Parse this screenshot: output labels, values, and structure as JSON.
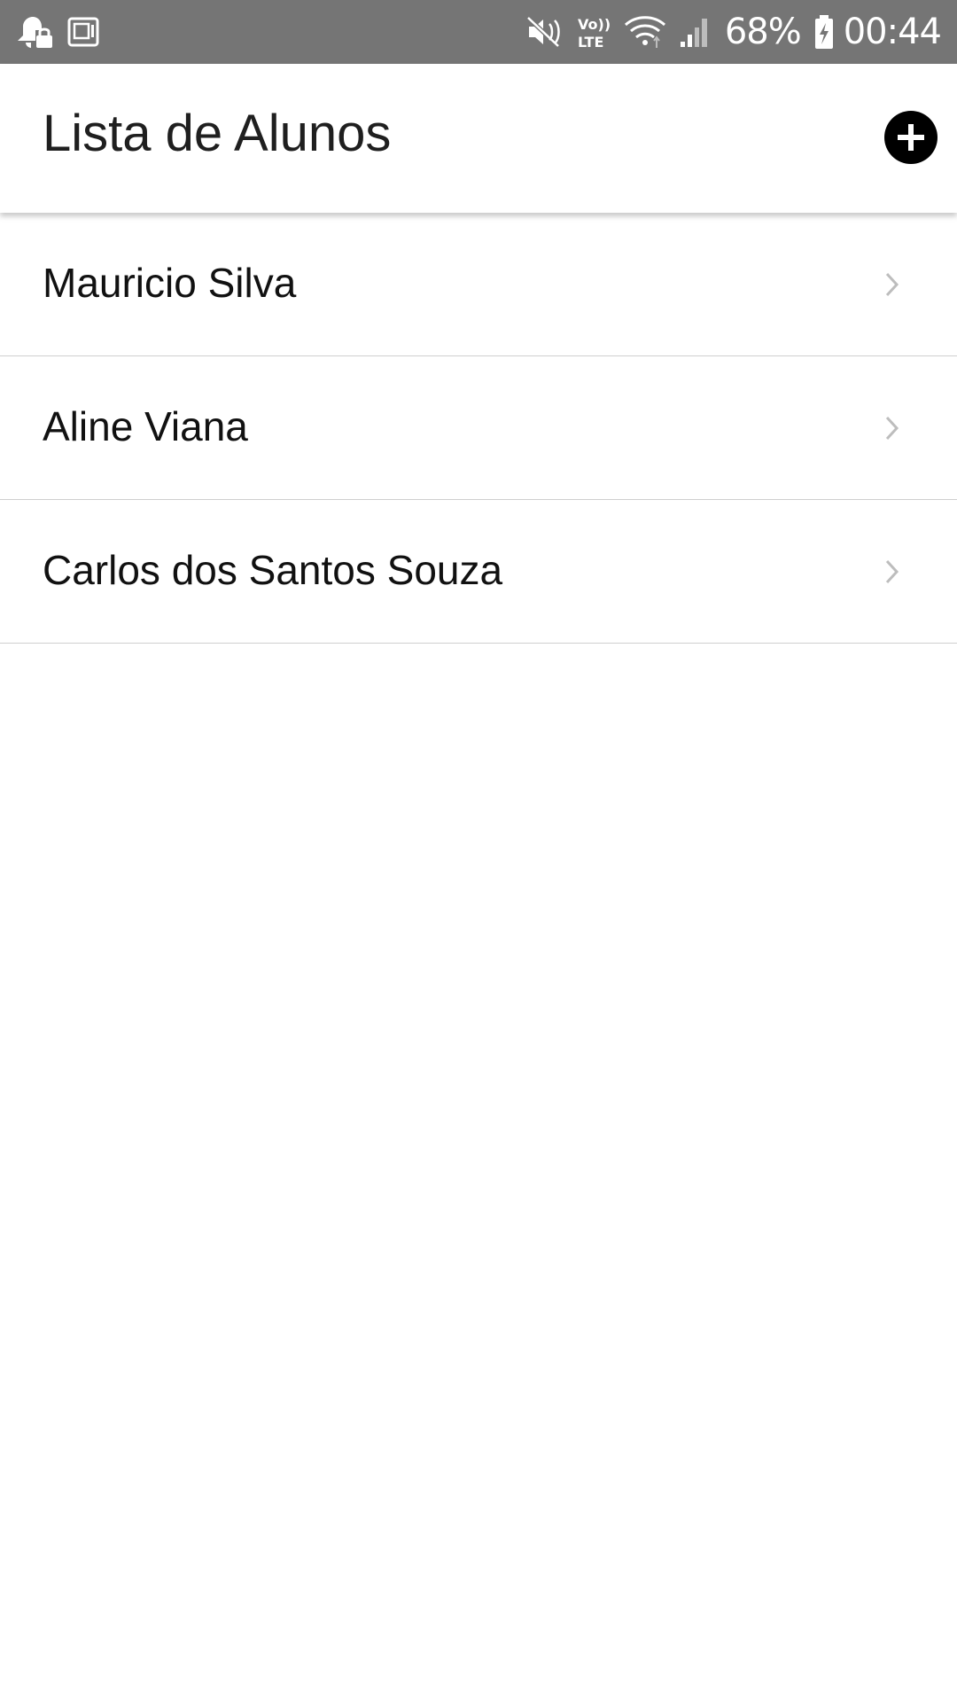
{
  "status_bar": {
    "battery_percent": "68%",
    "time": "00:44",
    "icons": [
      "notification-bell-lock-icon",
      "storage-card-icon",
      "mute-icon",
      "volte-lte-icon",
      "wifi-icon",
      "signal-icon",
      "battery-charging-icon"
    ],
    "background": "#757575"
  },
  "header": {
    "title": "Lista de Alunos",
    "add_icon": "plus-circle-icon"
  },
  "students": [
    {
      "name": "Mauricio Silva"
    },
    {
      "name": "Aline Viana"
    },
    {
      "name": "Carlos dos Santos Souza"
    }
  ],
  "colors": {
    "divider": "#cfcfcf",
    "chevron": "#bdbdbd",
    "text": "#111111"
  }
}
